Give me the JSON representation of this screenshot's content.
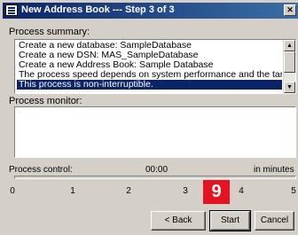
{
  "window": {
    "title": "New Address Book --- Step 3 of 3",
    "close_glyph": "✕"
  },
  "process_summary": {
    "label": "Process summary:",
    "lines": [
      "Create a new database: SampleDatabase",
      "Create a new DSN: MAS_SampleDatabase",
      "Create a new Address Book: Sample Database",
      "The process speed depends on system performance and the target action type.",
      "This process is non-interruptible."
    ],
    "selected_index": 4,
    "scroll_up": "▲",
    "scroll_down": "▼"
  },
  "process_monitor": {
    "label": "Process monitor:"
  },
  "process_control": {
    "label": "Process control:",
    "time": "00:00",
    "unit": "in minutes",
    "progress_fraction": 0,
    "scale": [
      "0",
      "1",
      "2",
      "3",
      "4",
      "5"
    ]
  },
  "badge": {
    "text": "9",
    "color": "#e8111f"
  },
  "buttons": {
    "back": "< Back",
    "start": "Start",
    "cancel": "Cancel"
  },
  "colors": {
    "selection": "#0a246a",
    "title_start": "#0a246a",
    "title_end": "#3a6ea5",
    "face": "#d4d0c8"
  }
}
